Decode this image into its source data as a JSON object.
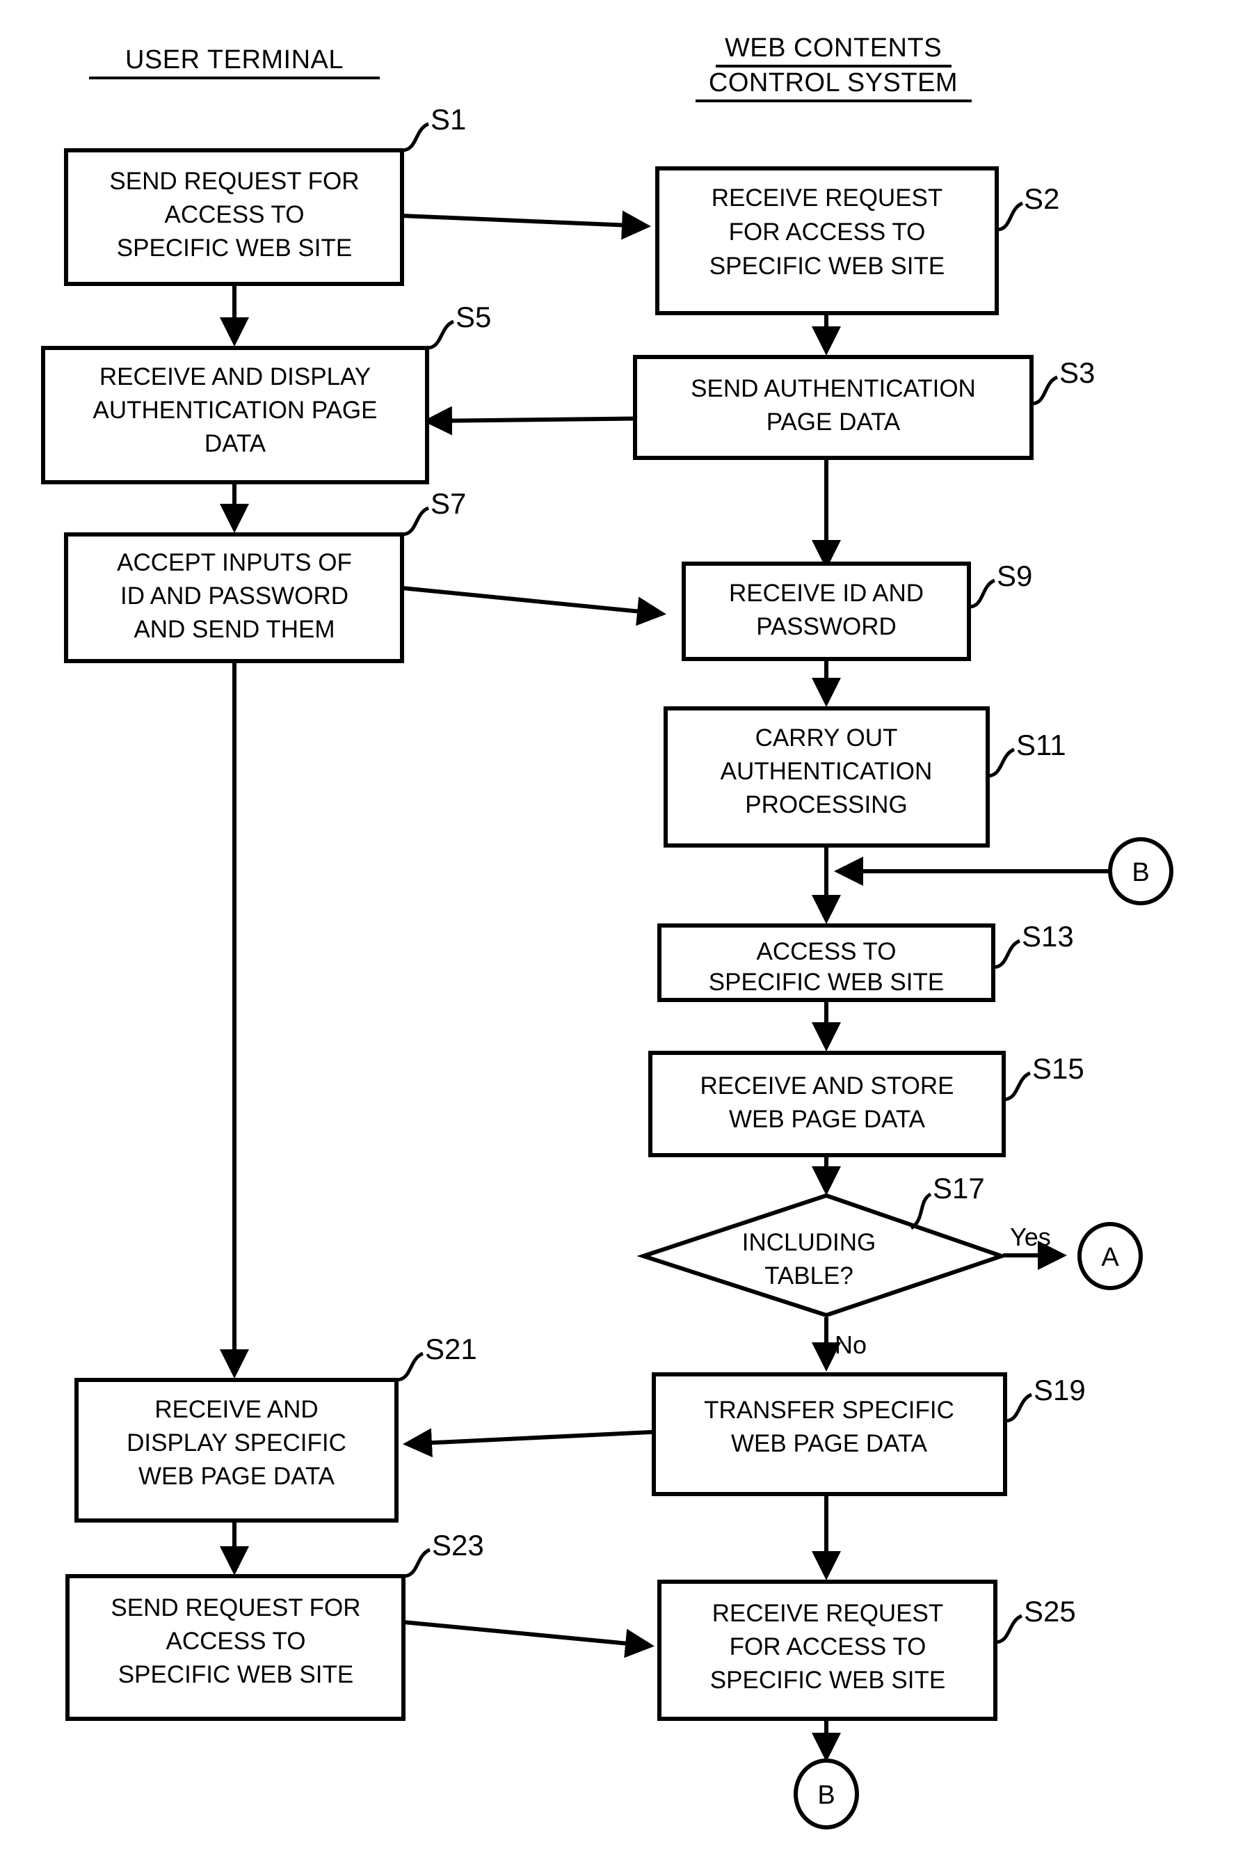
{
  "diagram": {
    "type": "flowchart",
    "lanes": [
      {
        "id": "user-terminal",
        "title": "USER TERMINAL"
      },
      {
        "id": "web-contents-control-system",
        "title_line1": "WEB CONTENTS",
        "title_line2": "CONTROL SYSTEM"
      }
    ],
    "nodes": [
      {
        "id": "s1",
        "step": "S1",
        "shape": "process",
        "lane": "user-terminal",
        "lines": [
          "SEND REQUEST FOR",
          "ACCESS TO",
          "SPECIFIC WEB SITE"
        ]
      },
      {
        "id": "s2",
        "step": "S2",
        "shape": "process",
        "lane": "web-contents-control-system",
        "lines": [
          "RECEIVE REQUEST",
          "FOR ACCESS TO",
          "SPECIFIC WEB SITE"
        ]
      },
      {
        "id": "s5",
        "step": "S5",
        "shape": "process",
        "lane": "user-terminal",
        "lines": [
          "RECEIVE AND DISPLAY",
          "AUTHENTICATION PAGE",
          "DATA"
        ]
      },
      {
        "id": "s3",
        "step": "S3",
        "shape": "process",
        "lane": "web-contents-control-system",
        "lines": [
          "SEND AUTHENTICATION",
          "PAGE DATA"
        ]
      },
      {
        "id": "s7",
        "step": "S7",
        "shape": "process",
        "lane": "user-terminal",
        "lines": [
          "ACCEPT INPUTS OF",
          "ID AND PASSWORD",
          "AND SEND THEM"
        ]
      },
      {
        "id": "s9",
        "step": "S9",
        "shape": "process",
        "lane": "web-contents-control-system",
        "lines": [
          "RECEIVE ID AND",
          "PASSWORD"
        ]
      },
      {
        "id": "s11",
        "step": "S11",
        "shape": "process",
        "lane": "web-contents-control-system",
        "lines": [
          "CARRY OUT",
          "AUTHENTICATION",
          "PROCESSING"
        ]
      },
      {
        "id": "s13",
        "step": "S13",
        "shape": "process",
        "lane": "web-contents-control-system",
        "lines": [
          "ACCESS TO",
          "SPECIFIC WEB SITE"
        ]
      },
      {
        "id": "s15",
        "step": "S15",
        "shape": "process",
        "lane": "web-contents-control-system",
        "lines": [
          "RECEIVE AND STORE",
          "WEB PAGE DATA"
        ]
      },
      {
        "id": "s17",
        "step": "S17",
        "shape": "decision",
        "lane": "web-contents-control-system",
        "lines": [
          "INCLUDING",
          "TABLE?"
        ]
      },
      {
        "id": "s21",
        "step": "S21",
        "shape": "process",
        "lane": "user-terminal",
        "lines": [
          "RECEIVE AND",
          "DISPLAY SPECIFIC",
          "WEB PAGE DATA"
        ]
      },
      {
        "id": "s19",
        "step": "S19",
        "shape": "process",
        "lane": "web-contents-control-system",
        "lines": [
          "TRANSFER SPECIFIC",
          "WEB PAGE DATA"
        ]
      },
      {
        "id": "s23",
        "step": "S23",
        "shape": "process",
        "lane": "user-terminal",
        "lines": [
          "SEND REQUEST FOR",
          "ACCESS TO",
          "SPECIFIC WEB SITE"
        ]
      },
      {
        "id": "s25",
        "step": "S25",
        "shape": "process",
        "lane": "web-contents-control-system",
        "lines": [
          "RECEIVE REQUEST",
          "FOR ACCESS TO",
          "SPECIFIC WEB SITE"
        ]
      }
    ],
    "connectors": [
      {
        "id": "conn-b-in",
        "label": "B",
        "shape": "circle"
      },
      {
        "id": "conn-a-out",
        "label": "A",
        "shape": "circle"
      },
      {
        "id": "conn-b-out",
        "label": "B",
        "shape": "circle"
      }
    ],
    "branch_labels": {
      "yes": "Yes",
      "no": "No"
    },
    "colors": {
      "stroke": "#000000",
      "fill": "#ffffff",
      "text": "#000000"
    }
  }
}
